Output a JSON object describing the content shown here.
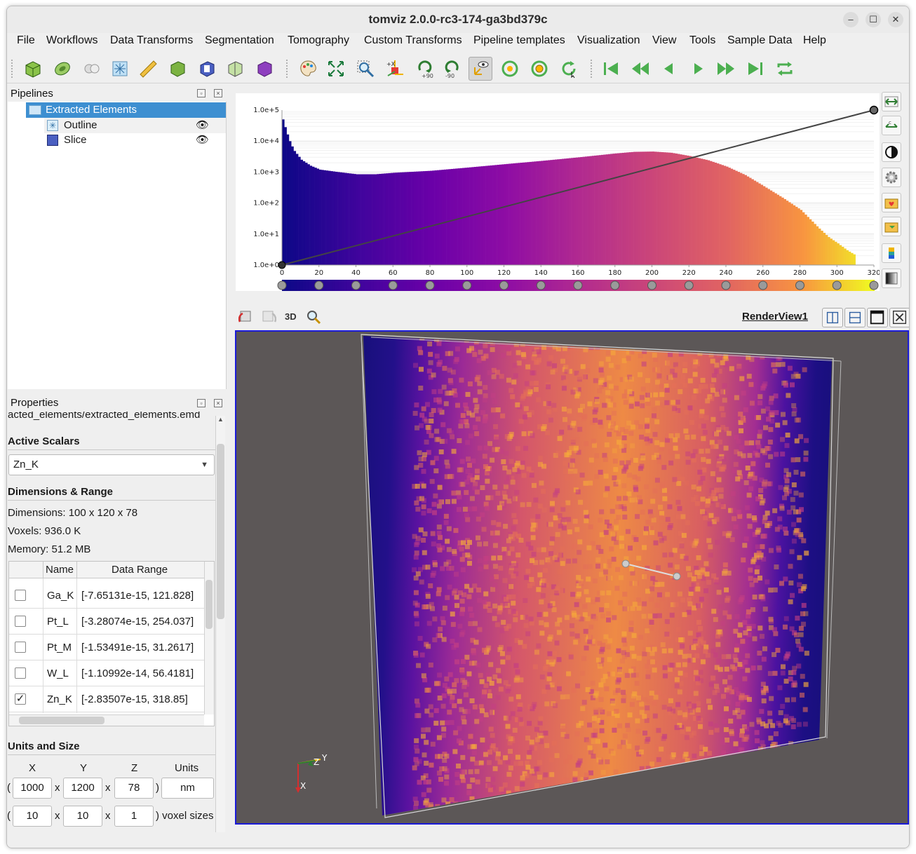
{
  "window": {
    "title": "tomviz 2.0.0-rc3-174-ga3bd379c",
    "minimize": "–",
    "maximize": "☐",
    "close": "✕"
  },
  "menu": [
    "File",
    "Workflows",
    "Data Transforms",
    "Segmentation",
    "Tomography",
    "Custom Transforms",
    "Pipeline templates",
    "Visualization",
    "View",
    "Tools",
    "Sample Data",
    "Help"
  ],
  "toolbar": {
    "rotate_labels": [
      "+90",
      "-90"
    ],
    "axis_label": "+X"
  },
  "pipelines": {
    "title": "Pipelines",
    "items": [
      {
        "label": "Extracted Elements",
        "selected": true
      },
      {
        "label": "Outline",
        "visible": true
      },
      {
        "label": "Slice",
        "visible": true
      }
    ]
  },
  "properties": {
    "title": "Properties",
    "file_path": "acted_elements/extracted_elements.emd",
    "active_scalars_heading": "Active Scalars",
    "active_scalars_value": "Zn_K",
    "dimensions_heading": "Dimensions & Range",
    "dimensions": "Dimensions: 100 x 120 x 78",
    "voxels": "Voxels: 936.0 K",
    "memory": "Memory: 51.2 MB",
    "table": {
      "headers": [
        "Name",
        "Data Range"
      ],
      "rows": [
        {
          "checked": false,
          "name": "Ga_K",
          "range": "[-7.65131e-15, 121.828]"
        },
        {
          "checked": false,
          "name": "Pt_L",
          "range": "[-3.28074e-15, 254.037]"
        },
        {
          "checked": false,
          "name": "Pt_M",
          "range": "[-1.53491e-15, 31.2617]"
        },
        {
          "checked": false,
          "name": "W_L",
          "range": "[-1.10992e-14, 56.4181]"
        },
        {
          "checked": true,
          "name": "Zn_K",
          "range": "[-2.83507e-15, 318.85]"
        }
      ]
    },
    "units_heading": "Units and Size",
    "units_cols": [
      "X",
      "Y",
      "Z",
      "Units"
    ],
    "size": {
      "x": "1000",
      "y": "1200",
      "z": "78",
      "units": "nm"
    },
    "voxel_size": {
      "x": "10",
      "y": "10",
      "z": "1",
      "suffix": ") voxel sizes"
    },
    "paren_open": "(",
    "paren_close": ")",
    "times": "x"
  },
  "chart_data": {
    "type": "bar",
    "x_range": [
      0,
      320
    ],
    "x_ticks": [
      "0",
      "20",
      "40",
      "60",
      "80",
      "100",
      "120",
      "140",
      "160",
      "180",
      "200",
      "220",
      "240",
      "260",
      "280",
      "300",
      "320"
    ],
    "y_scale": "log",
    "y_range": [
      1,
      100000
    ],
    "y_ticks": [
      "1.0e+0",
      "1.0e+1",
      "1.0e+2",
      "1.0e+3",
      "1.0e+4",
      "1.0e+5"
    ],
    "bins_x": [
      0,
      2,
      4,
      6,
      10,
      15,
      20,
      30,
      40,
      50,
      60,
      80,
      100,
      120,
      140,
      160,
      180,
      190,
      200,
      210,
      220,
      230,
      240,
      250,
      260,
      270,
      280,
      285,
      290,
      295,
      300,
      305,
      310
    ],
    "bins_y": [
      50000,
      20000,
      9000,
      5000,
      2500,
      1600,
      1200,
      1000,
      850,
      850,
      950,
      1100,
      1400,
      1800,
      2300,
      3000,
      4000,
      4500,
      4600,
      4200,
      3300,
      2400,
      1500,
      800,
      350,
      150,
      60,
      30,
      15,
      8,
      5,
      3,
      2
    ],
    "opacity_line": [
      [
        0,
        1
      ],
      [
        320,
        100000
      ]
    ],
    "colormap": "plasma",
    "control_points": 17
  },
  "renderview": {
    "title": "RenderView1",
    "mode_3d": "3D",
    "axis_x": "X",
    "axis_y": "Y",
    "axis_z": "Z"
  }
}
